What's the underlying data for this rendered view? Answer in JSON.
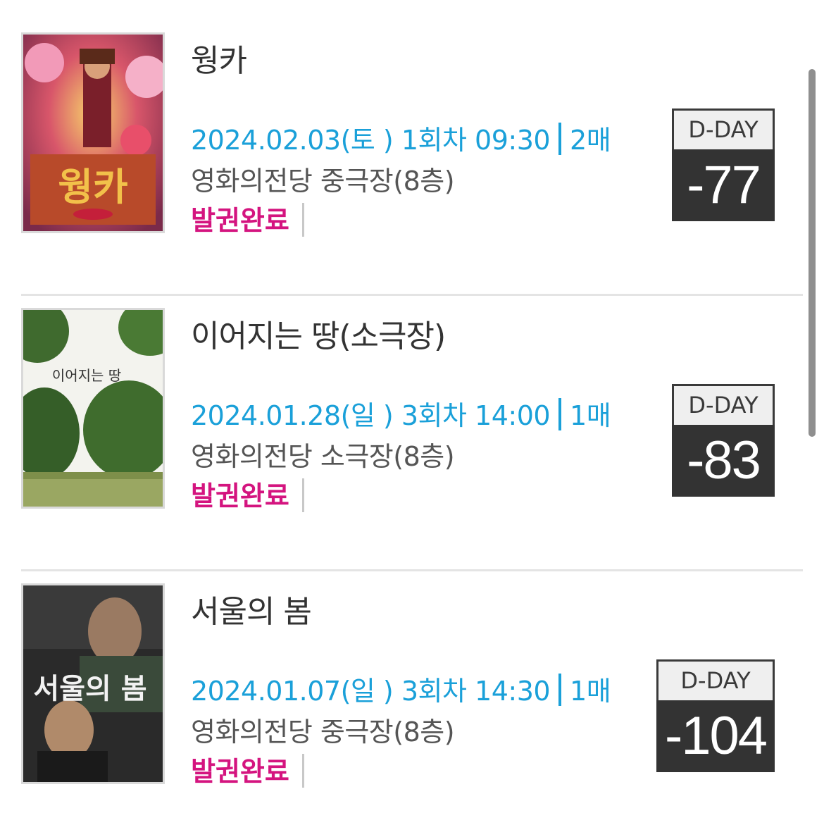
{
  "tickets": [
    {
      "title": "웡카",
      "date": "2024.02.03(토 )",
      "session": "1회차 09:30",
      "count": "2매",
      "venue": "영화의전당 중극장(8층)",
      "status": "발권완료",
      "dday_label": "D-DAY",
      "dday_value": "-77"
    },
    {
      "title": "이어지는 땅(소극장)",
      "date": "2024.01.28(일 )",
      "session": "3회차 14:00",
      "count": "1매",
      "venue": "영화의전당 소극장(8층)",
      "status": "발권완료",
      "dday_label": "D-DAY",
      "dday_value": "-83"
    },
    {
      "title": "서울의 봄",
      "date": "2024.01.07(일 )",
      "session": "3회차 14:30",
      "count": "1매",
      "venue": "영화의전당 중극장(8층)",
      "status": "발권완료",
      "dday_label": "D-DAY",
      "dday_value": "-104"
    }
  ],
  "colors": {
    "info": "#1aa0d9",
    "status": "#d4147f",
    "dday_bg": "#333333"
  }
}
